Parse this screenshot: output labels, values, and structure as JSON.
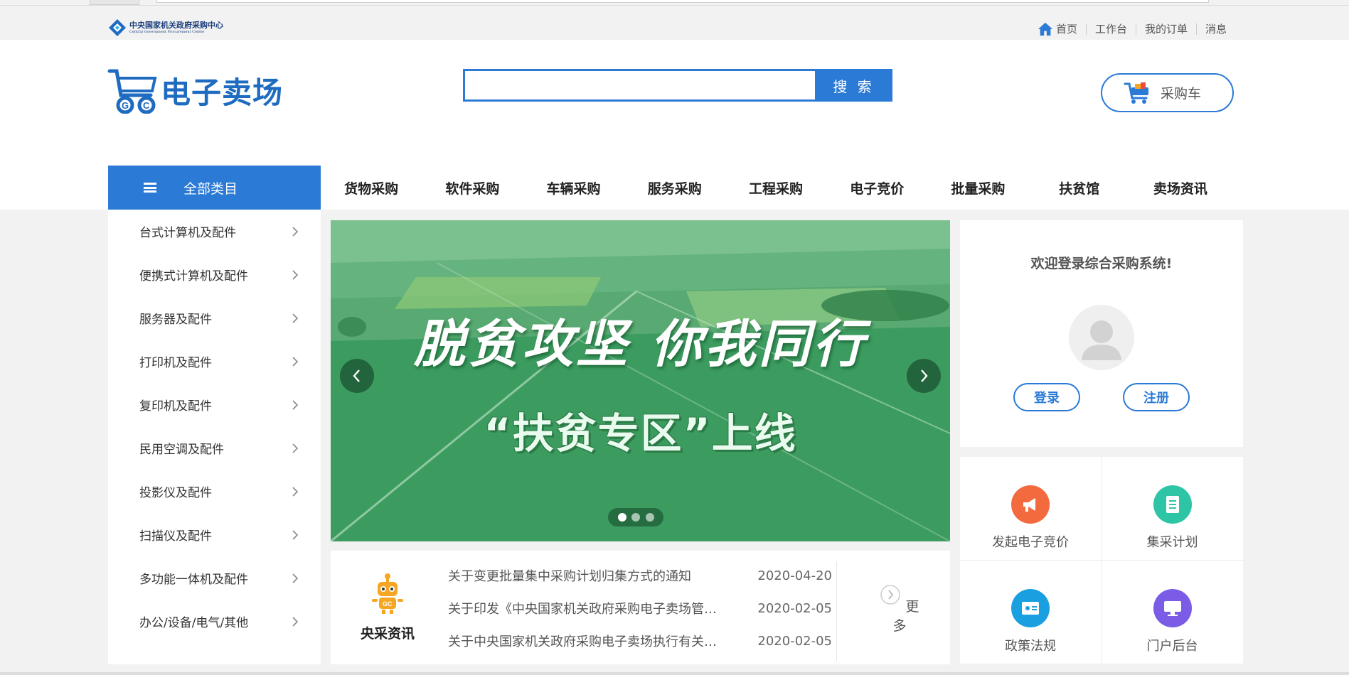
{
  "top": {
    "org_name_cn": "中央国家机关政府采购中心",
    "org_name_en": "Central Government Procurement Center",
    "links": [
      "首页",
      "工作台",
      "我的订单",
      "消息"
    ]
  },
  "header": {
    "brand": "电子卖场",
    "search_button": "搜 索",
    "search_value": "",
    "cart_label": "采购车"
  },
  "nav": {
    "all_categories": "全部类目",
    "items": [
      "货物采购",
      "软件采购",
      "车辆采购",
      "服务采购",
      "工程采购",
      "电子竞价",
      "批量采购",
      "扶贫馆",
      "卖场资讯"
    ]
  },
  "sidebar": {
    "categories": [
      "台式计算机及配件",
      "便携式计算机及配件",
      "服务器及配件",
      "打印机及配件",
      "复印机及配件",
      "民用空调及配件",
      "投影仪及配件",
      "扫描仪及配件",
      "多功能一体机及配件",
      "办公/设备/电气/其他"
    ]
  },
  "banner": {
    "headline": "脱贫攻坚 你我同行",
    "subline": "“扶贫专区”上线",
    "slide_count": 3,
    "active_slide": 1
  },
  "news": {
    "label": "央采资讯",
    "items": [
      {
        "title": "关于变更批量集中采购计划归集方式的通知",
        "date": "2020-04-20"
      },
      {
        "title": "关于印发《中央国家机关政府采购电子卖场管…",
        "date": "2020-02-05"
      },
      {
        "title": "关于中央国家机关政府采购电子卖场执行有关…",
        "date": "2020-02-05"
      }
    ],
    "more": "更多"
  },
  "login": {
    "welcome": "欢迎登录综合采购系统!",
    "login_button": "登录",
    "register_button": "注册"
  },
  "quick": {
    "items": [
      {
        "label": "发起电子竞价",
        "icon": "megaphone-icon",
        "color": "#f26a3d"
      },
      {
        "label": "集采计划",
        "icon": "document-list-icon",
        "color": "#2ec4a6"
      },
      {
        "label": "政策法规",
        "icon": "book-icon",
        "color": "#1a9fe0"
      },
      {
        "label": "门户后台",
        "icon": "monitor-icon",
        "color": "#7b5ce6"
      }
    ]
  },
  "colors": {
    "accent": "#2a7ad6",
    "banner_green": "#3b9b5f"
  }
}
